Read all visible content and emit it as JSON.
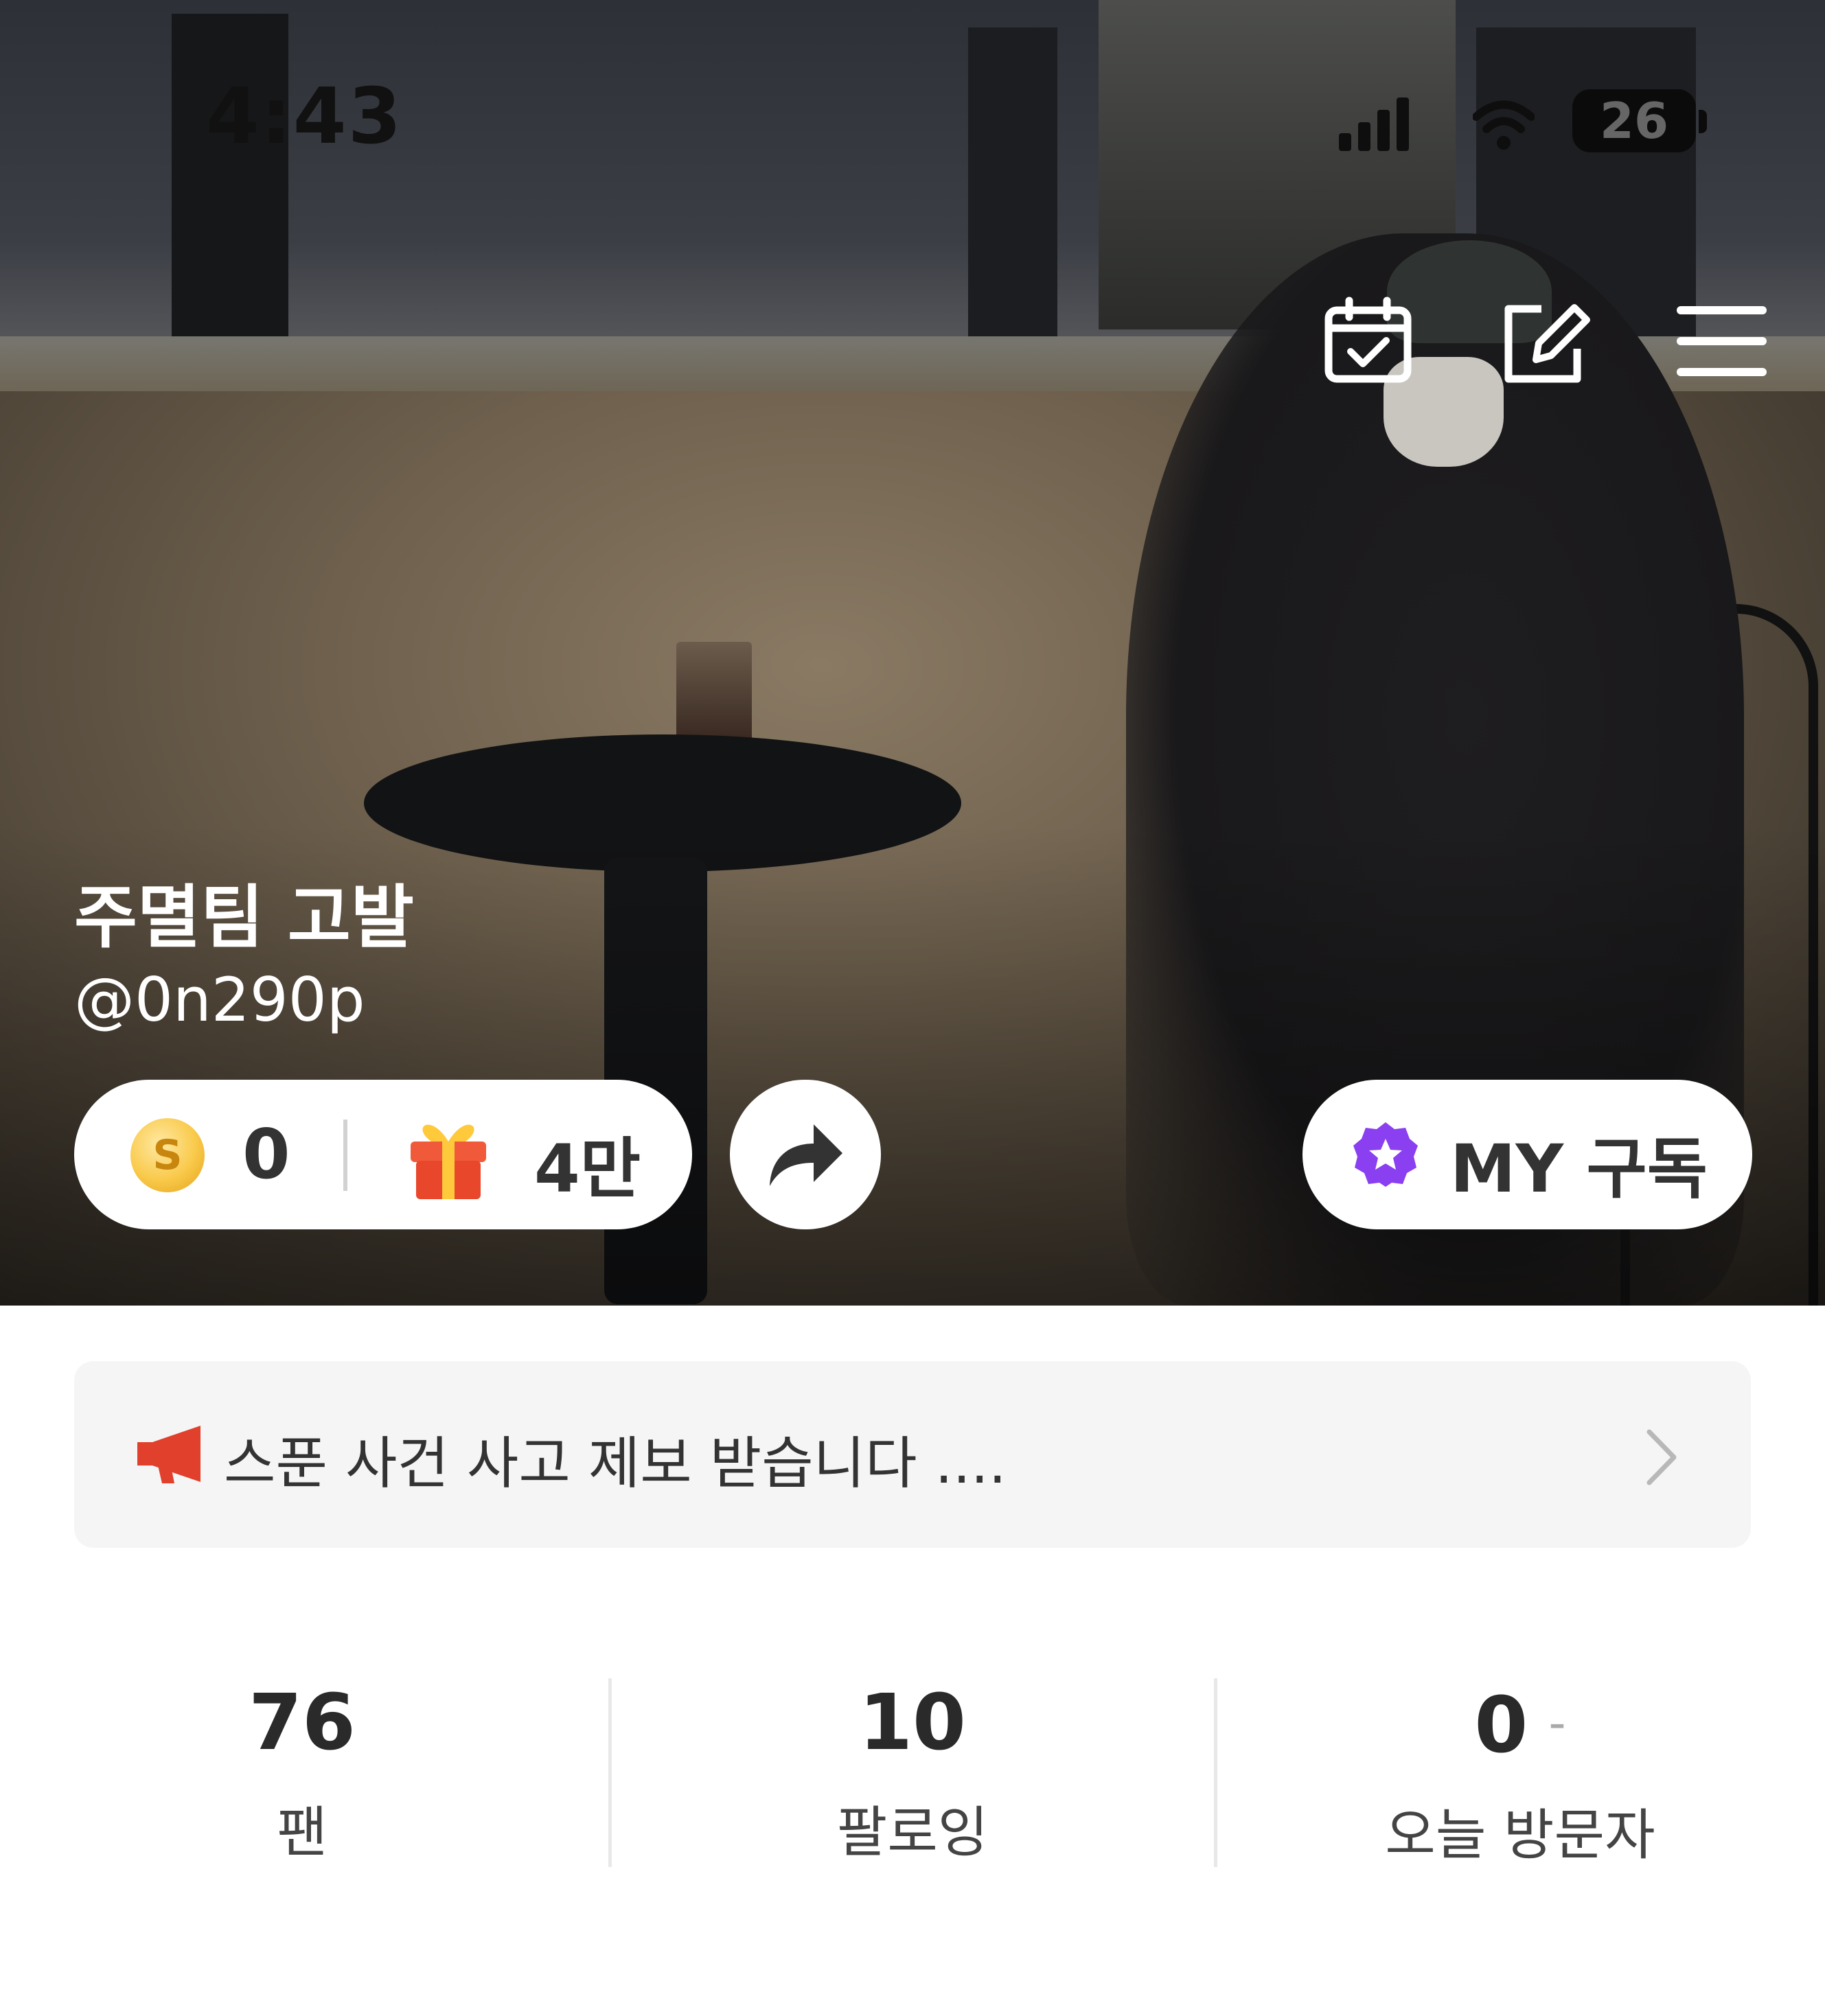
{
  "status_bar": {
    "time": "4:43",
    "battery": "26"
  },
  "profile": {
    "nickname": "주멸팀 고발",
    "handle": "@0n290p"
  },
  "wallet": {
    "coins": "0",
    "gifts": "4만"
  },
  "subscription": {
    "label": "MY 구독"
  },
  "notice": {
    "text": "스푼 사건 사고 제보 받습니다 ...."
  },
  "stats": [
    {
      "value": "76",
      "label": "팬"
    },
    {
      "value": "10",
      "label": "팔로잉"
    },
    {
      "value": "0",
      "label": "오늘 방문자",
      "extra": "-"
    }
  ],
  "icons": {
    "calendar": "calendar-check-icon",
    "edit": "edit-icon",
    "menu": "hamburger-menu-icon",
    "coin": "coin-icon",
    "gift": "gift-icon",
    "share": "share-icon",
    "subscription": "star-badge-icon",
    "notice": "megaphone-icon",
    "chevron": "chevron-right-icon"
  },
  "colors": {
    "accent_purple": "#8a3ff0",
    "notice_red": "#e0402c",
    "coin_gold": "#f9c94a"
  }
}
